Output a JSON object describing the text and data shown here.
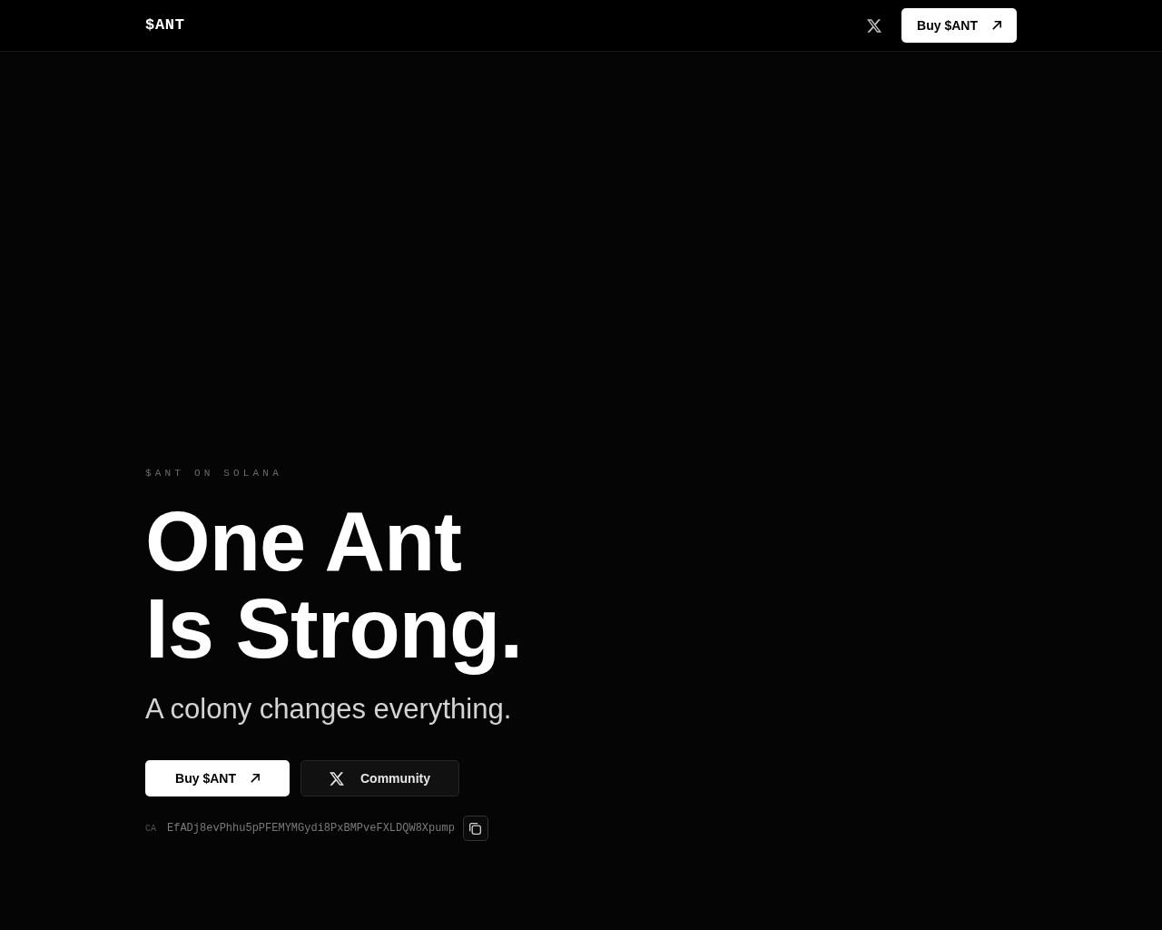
{
  "header": {
    "logo": "$ANT",
    "buttons": [
      {
        "kind": "icon"
      },
      {
        "kind": "primary",
        "label": "Buy $ANT"
      }
    ]
  },
  "hero": {
    "eyebrow": "$ANT ON SOLANA",
    "headline": [
      "One Ant",
      "Is Strong."
    ],
    "subtitle": "A colony changes everything.",
    "buttons": [
      {
        "kind": "primary",
        "label": "Buy $ANT"
      },
      {
        "kind": "secondary",
        "label": "Community"
      }
    ],
    "contract": {
      "label": "CA",
      "address": "EfADj8evPhhu5pPFEMYMGydi8PxBMPveFXLDQW8Xpump"
    }
  }
}
